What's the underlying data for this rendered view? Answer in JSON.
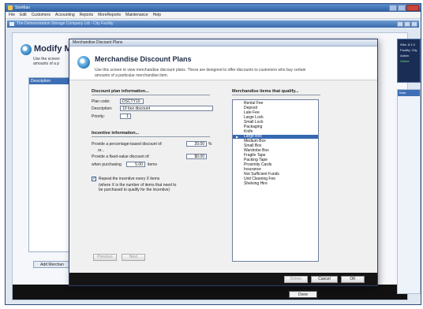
{
  "app": {
    "title": "StorMan",
    "menu": [
      "File",
      "Edit",
      "Customers",
      "Accounting",
      "Reports",
      "MoreReports",
      "Maintenance",
      "Help"
    ]
  },
  "inner_window": {
    "title": "The Demonstration Storage Company Ltd - City Facility"
  },
  "underlying": {
    "heading": "Modify M",
    "desc_line1": "Use the screen",
    "desc_line2": "amounts of a p",
    "list_header": "Description",
    "add_button": "Add Merchan",
    "done_button": "Done"
  },
  "side_panel": {
    "lines": [
      "Wks: 8.1.0",
      "Facility: City",
      "Admin",
      "Online"
    ],
    "list_header": "Note"
  },
  "dialog": {
    "title": "Merchandise Discount Plans",
    "heading": "Merchandise Discount Plans",
    "desc_line1": "Use this screen to view merchandise discount plans. These are designed to offer discounts to customers who buy certain",
    "desc_line2": "amounts of a particular merchandise item.",
    "plan_info": {
      "title": "Discount plan information...",
      "plan_code_label": "Plan code:",
      "plan_code": "DSCTY10",
      "description_label": "Description:",
      "description": "10 box discount",
      "priority_label": "Priority:",
      "priority": "1"
    },
    "incentive": {
      "title": "Incentive information...",
      "pct_label": "Provide a percentage-based discount of:",
      "pct_value": "20.00",
      "pct_unit": "%",
      "or_label": "or...",
      "fixed_label": "Provide a fixed-value discount of:",
      "fixed_value": "$0.00",
      "when_label": "when purchasing",
      "when_value": "5.00",
      "when_unit": "items",
      "repeat_checked": true,
      "repeat_label": "Repeat the incentive every X items",
      "repeat_note1": "(where X is the number of items that need to",
      "repeat_note2": "be purchased to qualify for the incentive)"
    },
    "items": {
      "title": "Merchandise items that qualify...",
      "list": [
        "Rental Fee",
        "Deposit",
        "Late Fee",
        "Large Lock",
        "Small Lock",
        "Packaging",
        "Knife",
        "Large Box",
        "Medium Box",
        "Small Box",
        "Wardrobe Box",
        "Fragile Tape",
        "Packing Tape",
        "Proximity Cards",
        "Insurance",
        "Not Sufficient Funds",
        "Unit Cleaning Fee",
        "Shelving Hire"
      ],
      "selected": "Large Box"
    },
    "buttons": {
      "previous": "Previous",
      "next": "Next",
      "delete": "Delete",
      "cancel": "Cancel",
      "ok": "OK"
    }
  }
}
